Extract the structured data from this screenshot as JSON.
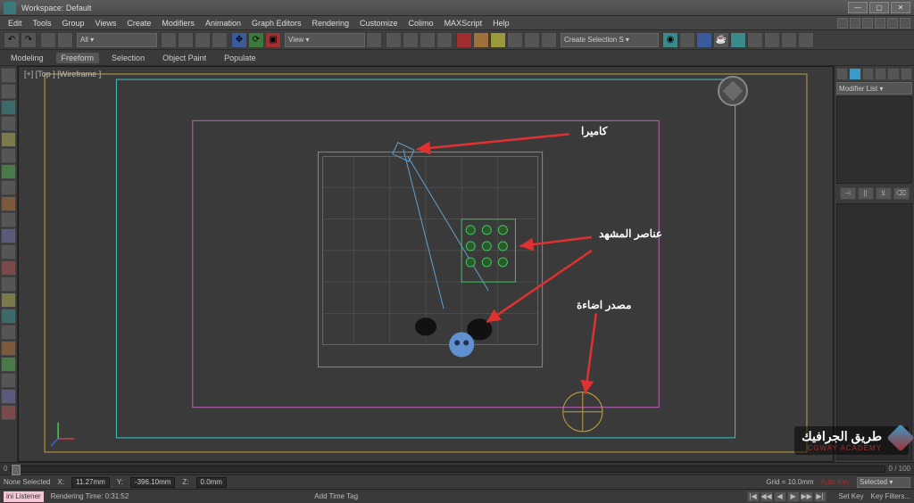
{
  "titlebar": {
    "workspace_label": "Workspace: Default"
  },
  "menu": {
    "items": [
      "Edit",
      "Tools",
      "Group",
      "Views",
      "Create",
      "Modifiers",
      "Animation",
      "Graph Editors",
      "Rendering",
      "Customize",
      "Colimo",
      "MAXScript",
      "Help"
    ]
  },
  "toolbar": {
    "view_dd": "View ▾",
    "create_dd": "Create Selection S ▾"
  },
  "ribbon": {
    "tabs": [
      "Modeling",
      "Freeform",
      "Selection",
      "Object Paint",
      "Populate"
    ],
    "active": 1
  },
  "viewport": {
    "label": "[+] [Top ] [Wireframe ]"
  },
  "annotations": {
    "camera": "كاميرا",
    "elements": "عناصر المشهد",
    "light": "مصدر اضاءة"
  },
  "rightpanel": {
    "modifier_list": "Modifier List ▾"
  },
  "timeline": {
    "start": "0",
    "end": "0 / 100"
  },
  "status": {
    "none_selected": "None Selected",
    "x_label": "X:",
    "x": "11.27mm",
    "y_label": "Y:",
    "y": "-396.10mm",
    "z_label": "Z:",
    "z": "0.0mm",
    "grid": "Grid = 10.0mm",
    "autokey": "Auto Key",
    "selected_dd": "Selected ▾"
  },
  "bottom": {
    "listener": "ini Listener",
    "rendering": "Rendering Time: 0:31:52",
    "addtag": "Add Time Tag",
    "setkey": "Set Key",
    "keyfilters": "Key Filters..."
  },
  "watermark": {
    "line1": "طريق الجرافيك",
    "line2": "CGWAY ACADEMY"
  },
  "playback": {
    "buttons": [
      "|◀",
      "◀◀",
      "◀",
      "▶",
      "▶▶",
      "▶|"
    ]
  }
}
